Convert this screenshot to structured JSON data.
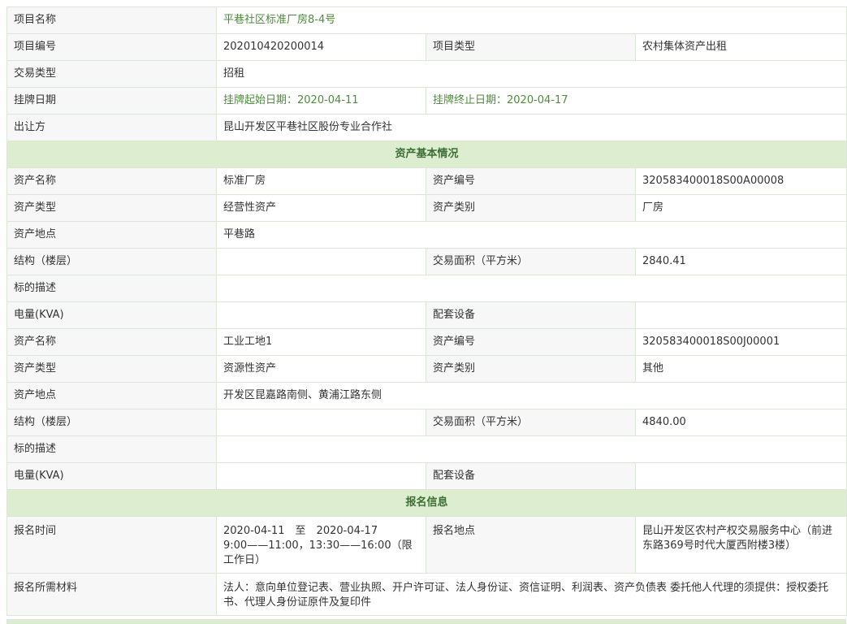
{
  "project": {
    "name_label": "项目名称",
    "name_value": "平巷社区标准厂房8-4号",
    "code_label": "项目编号",
    "code_value": "202010420200014",
    "type_label": "项目类型",
    "type_value": "农村集体资产出租",
    "trade_label": "交易类型",
    "trade_value": "招租",
    "listing_label": "挂牌日期",
    "listing_start": "挂牌起始日期：2020-04-11",
    "listing_end": "挂牌终止日期：2020-04-17",
    "transferor_label": "出让方",
    "transferor_value": "昆山开发区平巷社区股份专业合作社"
  },
  "sections": {
    "asset_basic": "资产基本情况",
    "signup_info": "报名信息"
  },
  "labels": {
    "asset_name": "资产名称",
    "asset_code": "资产编号",
    "asset_type": "资产类型",
    "asset_category": "资产类别",
    "asset_location": "资产地点",
    "structure": "结构（楼层）",
    "trade_area": "交易面积（平方米）",
    "target_desc": "标的描述",
    "power": "电量(KVA)",
    "facilities": "配套设备"
  },
  "assets": [
    {
      "name": "标准厂房",
      "code": "320583400018S00A00008",
      "type": "经营性资产",
      "category": "厂房",
      "location": "平巷路",
      "structure": "",
      "area": "2840.41",
      "desc": "",
      "power": "",
      "facilities": ""
    },
    {
      "name": "工业工地1",
      "code": "320583400018S00J00001",
      "type": "资源性资产",
      "category": "其他",
      "location": "开发区昆嘉路南侧、黄浦江路东侧",
      "structure": "",
      "area": "4840.00",
      "desc": "",
      "power": "",
      "facilities": ""
    }
  ],
  "signup": {
    "time_label": "报名时间",
    "time_line1": "2020-04-11　至　2020-04-17",
    "time_line2": "9:00——11:00，13:30——16:00（限工作日）",
    "place_label": "报名地点",
    "place_value": "昆山开发区农村产权交易服务中心（前进东路369号时代大厦西附楼3楼）",
    "materials_label": "报名所需材料",
    "materials_value": "法人：意向单位登记表、营业执照、开户许可证、法人身份证、资信证明、利润表、资产负债表 委托他人代理的须提供：授权委托书、代理人身份证原件及复印件"
  }
}
